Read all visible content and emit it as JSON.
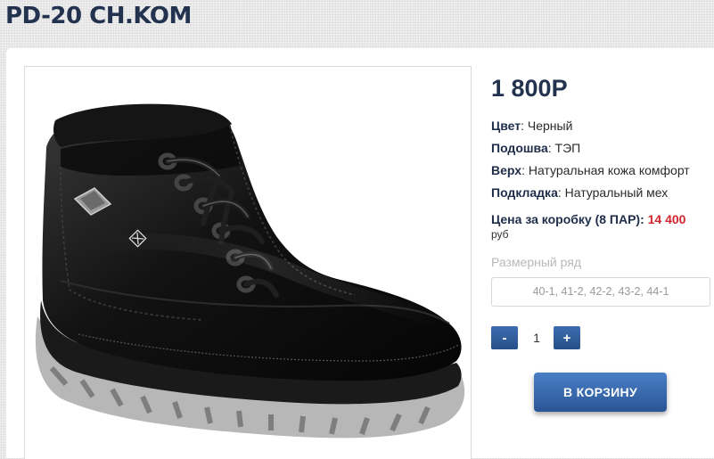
{
  "product": {
    "title": "PD-20 CH.KOM",
    "price": "1 800Р",
    "image_alt": "black leather lace-up winter boot",
    "specs": [
      {
        "label": "Цвет",
        "value": "Черный"
      },
      {
        "label": "Подошва",
        "value": "ТЭП"
      },
      {
        "label": "Верх",
        "value": "Натуральная кожа комфорт"
      },
      {
        "label": "Подкладка",
        "value": "Натуральный мех"
      }
    ],
    "box_price": {
      "label": "Цена за коробку (8 ПАР):",
      "amount": "14 400",
      "unit": "руб"
    }
  },
  "size": {
    "label": "Размерный ряд",
    "value": "40-1, 41-2, 42-2, 43-2, 44-1"
  },
  "quantity": {
    "minus": "-",
    "value": "1",
    "plus": "+"
  },
  "cart": {
    "label": "В КОРЗИНУ"
  },
  "colors": {
    "title": "#23334f",
    "accent": "#2f5d9a",
    "price_red": "#d0262e"
  }
}
